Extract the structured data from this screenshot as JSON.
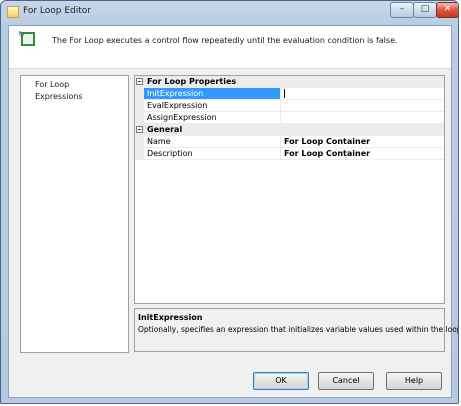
{
  "window": {
    "title": "For Loop Editor",
    "controls": {
      "minimize": "–",
      "maximize": "□",
      "close": "✕"
    }
  },
  "header": {
    "description": "The For Loop executes a control flow repeatedly until the evaluation condition is false.",
    "icon": "for-loop-container-icon"
  },
  "navigation": {
    "items": [
      {
        "label": "For Loop",
        "selected": true
      },
      {
        "label": "Expressions",
        "selected": false
      }
    ]
  },
  "property_grid": {
    "categories": [
      {
        "label": "For Loop Properties",
        "expanded": true,
        "properties": [
          {
            "name": "InitExpression",
            "value": "",
            "selected": true
          },
          {
            "name": "EvalExpression",
            "value": ""
          },
          {
            "name": "AssignExpression",
            "value": ""
          }
        ]
      },
      {
        "label": "General",
        "expanded": true,
        "properties": [
          {
            "name": "Name",
            "value": "For Loop Container"
          },
          {
            "name": "Description",
            "value": "For Loop Container"
          }
        ]
      }
    ]
  },
  "description_pane": {
    "title": "InitExpression",
    "text": "Optionally, specifies an expression that initializes variable values used within the loop."
  },
  "buttons": {
    "ok": "OK",
    "cancel": "Cancel",
    "help": "Help"
  },
  "colors": {
    "selection": "#3399ff",
    "titlebar": "#b9cde4",
    "close_button": "#c53a23"
  }
}
